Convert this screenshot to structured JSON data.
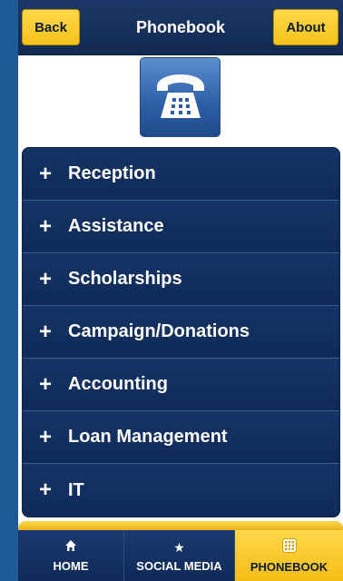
{
  "header": {
    "back_label": "Back",
    "title": "Phonebook",
    "about_label": "About"
  },
  "logo": {
    "icon": "telephone-icon"
  },
  "list": {
    "items": [
      {
        "icon": "plus-icon",
        "label": "Reception"
      },
      {
        "icon": "plus-icon",
        "label": "Assistance"
      },
      {
        "icon": "plus-icon",
        "label": "Scholarships"
      },
      {
        "icon": "plus-icon",
        "label": "Campaign/Donations"
      },
      {
        "icon": "plus-icon",
        "label": "Accounting"
      },
      {
        "icon": "plus-icon",
        "label": "Loan Management"
      },
      {
        "icon": "plus-icon",
        "label": "IT"
      }
    ]
  },
  "tabbar": {
    "tabs": [
      {
        "icon": "home-icon",
        "label": "HOME",
        "active": false
      },
      {
        "icon": "star-icon",
        "label": "SOCIAL MEDIA",
        "active": false
      },
      {
        "icon": "grid-icon",
        "label": "PHONEBOOK",
        "active": true
      }
    ]
  },
  "colors": {
    "navy": "#0f2a57",
    "accent_yellow": "#f6c21b",
    "background_blue": "#2b6aa8"
  }
}
